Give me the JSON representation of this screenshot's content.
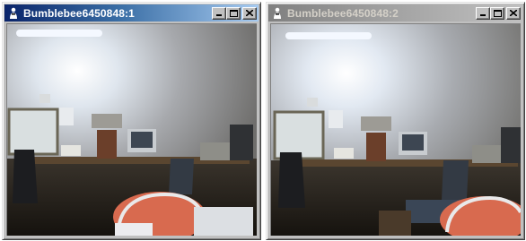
{
  "windows": [
    {
      "title": "Bumblebee6450848:1",
      "state": "active",
      "icon": "bumblebee-app-icon",
      "controls": [
        "minimize-icon",
        "maximize-icon",
        "close-icon"
      ]
    },
    {
      "title": "Bumblebee6450848:2",
      "state": "inactive",
      "icon": "bumblebee-app-icon",
      "controls": [
        "minimize-icon",
        "maximize-icon",
        "close-icon"
      ]
    }
  ],
  "colors": {
    "active_title": "#0a246a",
    "inactive_title": "#808080",
    "chrome": "#c0c0c0"
  }
}
